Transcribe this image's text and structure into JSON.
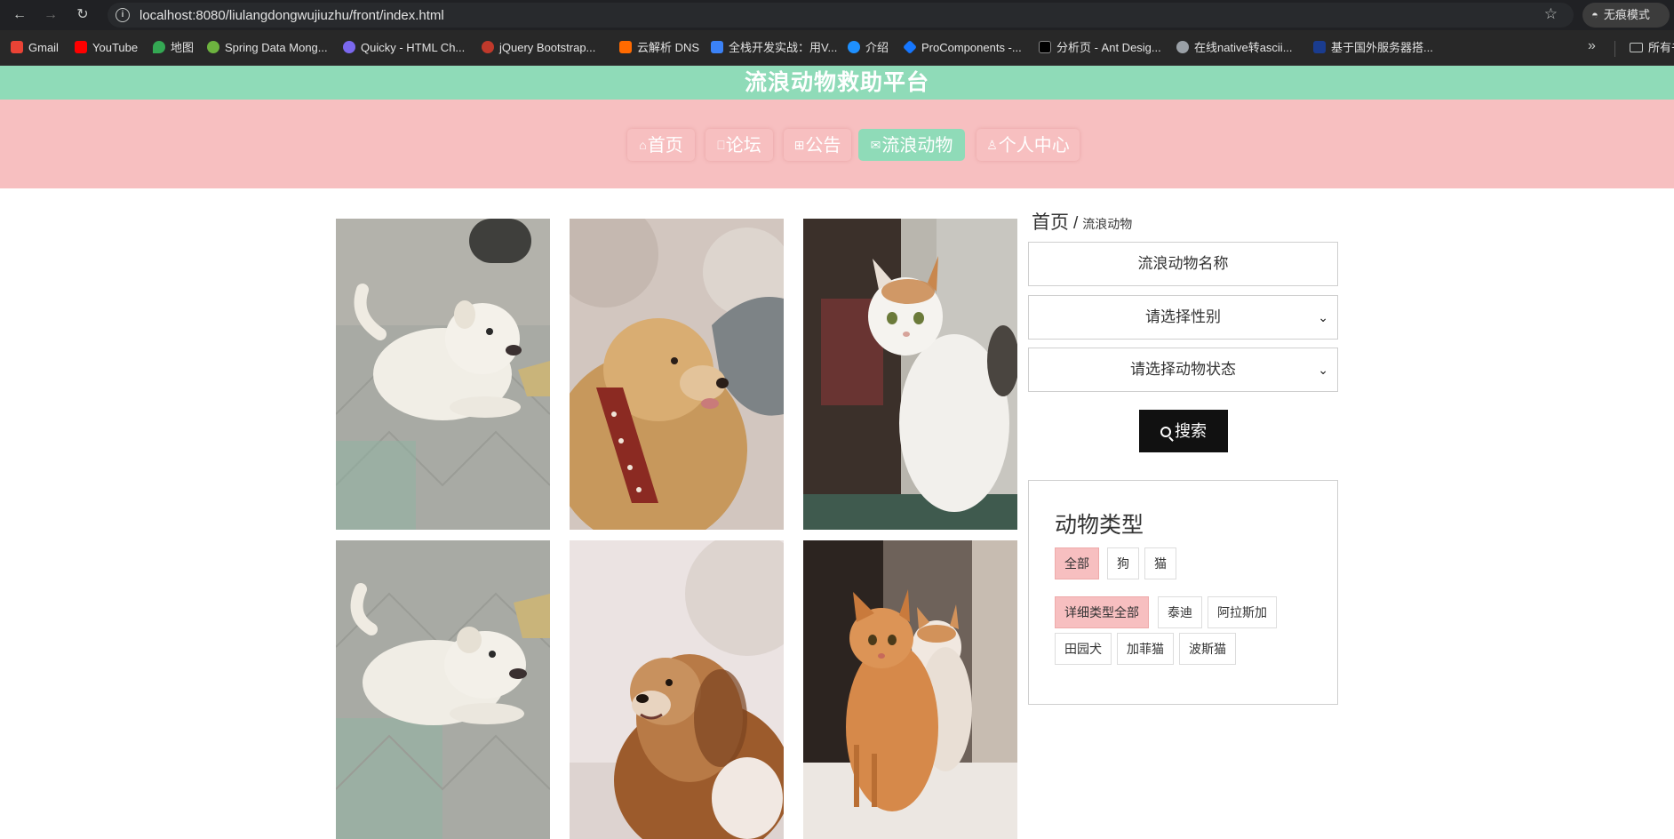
{
  "browser": {
    "url": "localhost:8080/liulangdongwujiuzhu/front/index.html",
    "incognito_label": "无痕模式",
    "all_bookmarks_label": "所有书",
    "bookmarks": [
      {
        "label": "Gmail",
        "color": "#ea4335"
      },
      {
        "label": "YouTube",
        "color": "#ff0000"
      },
      {
        "label": "地图",
        "color": "#34a853"
      },
      {
        "label": "Spring Data Mong...",
        "color": "#6db33f"
      },
      {
        "label": "Quicky - HTML Ch...",
        "color": "#7b68ee"
      },
      {
        "label": "jQuery Bootstrap...",
        "color": "#c0392b"
      },
      {
        "label": "云解析 DNS",
        "color": "#ff6a00"
      },
      {
        "label": "全栈开发实战：用V...",
        "color": "#3b82f6"
      },
      {
        "label": "介绍",
        "color": "#1e90ff"
      },
      {
        "label": "ProComponents -...",
        "color": "#1677ff"
      },
      {
        "label": "分析页 - Ant Desig...",
        "color": "#000000"
      },
      {
        "label": "在线native转ascii...",
        "color": "#9aa0a6"
      },
      {
        "label": "基于国外服务器搭...",
        "color": "#1a3c8f"
      }
    ]
  },
  "site": {
    "title": "流浪动物救助平台",
    "accent_color": "#8fdbb8",
    "nav_bg_color": "#f7bfc0"
  },
  "nav": {
    "items": [
      {
        "label": "首页",
        "icon": "home-icon"
      },
      {
        "label": "论坛",
        "icon": "book-icon"
      },
      {
        "label": "公告",
        "icon": "gift-icon"
      },
      {
        "label": "流浪动物",
        "icon": "mail-icon"
      },
      {
        "label": "个人中心",
        "icon": "user-icon"
      }
    ],
    "active": "流浪动物"
  },
  "gallery": {
    "items": [
      {
        "subject": "white puppy lying on pavement"
      },
      {
        "subject": "golden dog with red collar"
      },
      {
        "subject": "white calico cat sitting"
      },
      {
        "subject": "white puppy lying on pavement"
      },
      {
        "subject": "fluffy pekingese dog"
      },
      {
        "subject": "two orange cats"
      }
    ]
  },
  "sidebar": {
    "breadcrumb": {
      "home": "首页",
      "separator": "/",
      "current": "流浪动物"
    },
    "name_input_placeholder": "流浪动物名称",
    "gender_select": "请选择性别",
    "status_select": "请选择动物状态",
    "search_label": "搜索",
    "type_panel": {
      "title": "动物类型",
      "types": [
        "全部",
        "狗",
        "猫"
      ],
      "subtypes": [
        "详细类型全部",
        "泰迪",
        "阿拉斯加",
        "田园犬",
        "加菲猫",
        "波斯猫"
      ]
    }
  }
}
